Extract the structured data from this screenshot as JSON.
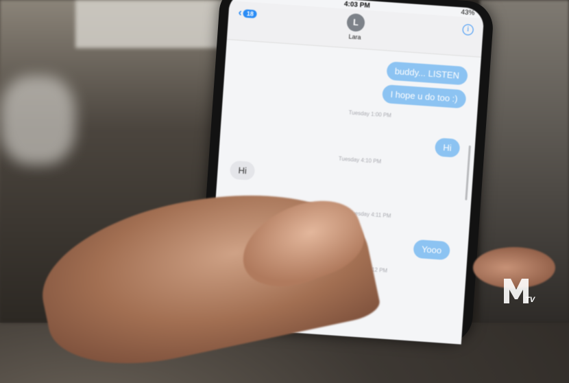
{
  "status": {
    "time": "4:03 PM",
    "battery": "43%"
  },
  "nav": {
    "back_count": "18",
    "avatar_initial": "L",
    "contact_name": "Lara",
    "info_glyph": "i"
  },
  "messages": [
    {
      "type": "sent",
      "text": "buddy... LISTEN"
    },
    {
      "type": "sent",
      "text": "I hope u do too :)"
    },
    {
      "type": "stamp",
      "text": "Tuesday 1:00 PM"
    },
    {
      "type": "sent",
      "text": "Hi"
    },
    {
      "type": "stamp",
      "text": "Tuesday 4:10 PM"
    },
    {
      "type": "received",
      "text": "Hi"
    },
    {
      "type": "stamp",
      "text": "Tuesday 4:11 PM"
    },
    {
      "type": "sent",
      "text": "Yooo"
    },
    {
      "type": "stamp",
      "text": "Tuesday 4:12 PM"
    }
  ],
  "watermark": {
    "brand": "MTV",
    "color": "#ffffff"
  }
}
